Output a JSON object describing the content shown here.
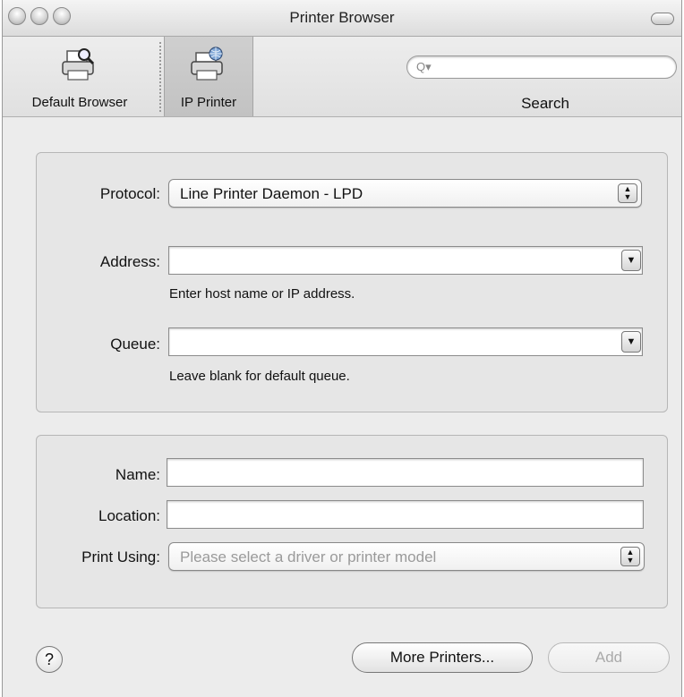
{
  "window": {
    "title": "Printer Browser"
  },
  "toolbar": {
    "default_browser_label": "Default Browser",
    "ip_printer_label": "IP Printer",
    "search_label": "Search",
    "search_placeholder": ""
  },
  "connection": {
    "protocol_label": "Protocol:",
    "protocol_value": "Line Printer Daemon - LPD",
    "address_label": "Address:",
    "address_value": "",
    "address_hint": "Enter host name or IP address.",
    "queue_label": "Queue:",
    "queue_value": "",
    "queue_hint": "Leave blank for default queue."
  },
  "details": {
    "name_label": "Name:",
    "name_value": "",
    "location_label": "Location:",
    "location_value": "",
    "print_using_label": "Print Using:",
    "print_using_value": "Please select a driver or printer model"
  },
  "buttons": {
    "help": "?",
    "more_printers": "More Printers...",
    "add": "Add"
  }
}
